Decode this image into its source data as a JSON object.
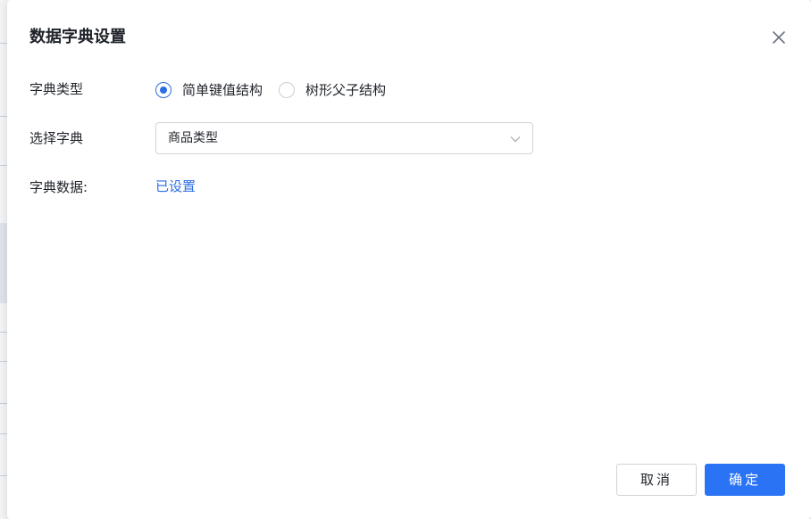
{
  "dialog": {
    "title": "数据字典设置",
    "close_icon": "close-icon"
  },
  "form": {
    "dict_type": {
      "label": "字典类型",
      "options": [
        {
          "label": "简单键值结构",
          "selected": true
        },
        {
          "label": "树形父子结构",
          "selected": false
        }
      ]
    },
    "select_dict": {
      "label": "选择字典",
      "value": "商品类型",
      "arrow_icon": "chevron-down-icon"
    },
    "dict_data": {
      "label": "字典数据:",
      "link_text": "已设置"
    }
  },
  "footer": {
    "cancel_label": "取消",
    "ok_label": "确定"
  },
  "colors": {
    "primary": "#2b73f5",
    "link": "#2b6de5",
    "border": "#d0d3d9",
    "text": "#1f2329"
  }
}
